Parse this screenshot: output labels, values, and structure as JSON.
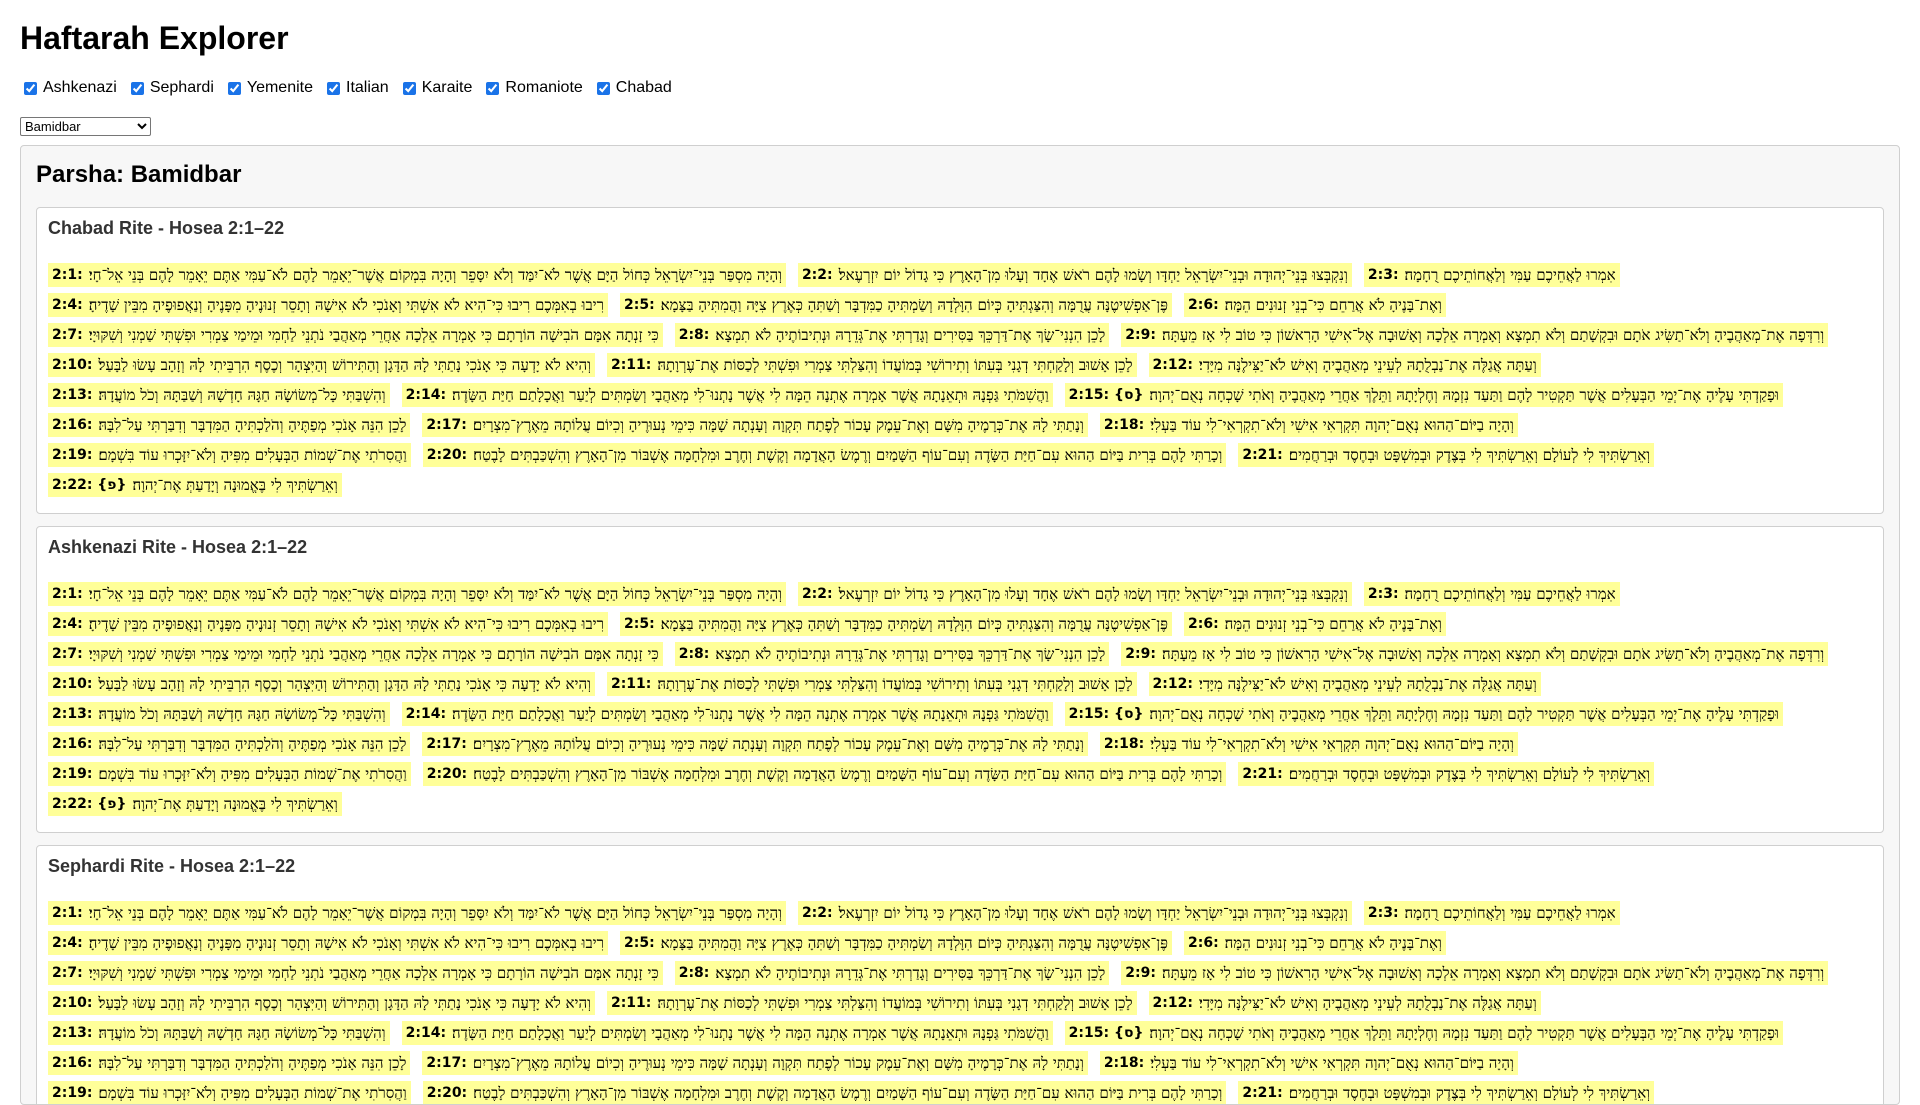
{
  "app": {
    "title": "Haftarah Explorer"
  },
  "filters": [
    {
      "label": "Ashkenazi",
      "checked": true
    },
    {
      "label": "Sephardi",
      "checked": true
    },
    {
      "label": "Yemenite",
      "checked": true
    },
    {
      "label": "Italian",
      "checked": true
    },
    {
      "label": "Karaite",
      "checked": true
    },
    {
      "label": "Romaniote",
      "checked": true
    },
    {
      "label": "Chabad",
      "checked": true
    }
  ],
  "parsha_select": {
    "selected": "Bamidbar"
  },
  "parsha": {
    "title": "Parsha: Bamidbar"
  },
  "verses": [
    {
      "ref": "2:1:",
      "text": "וְהָיָה מִסְפַּר בְּנֵי־יִשְׂרָאֵל כְּחוֹל הַיָּם אֲשֶׁר לֹא־יִמַּד וְלֹא יִסָּפֵר וְהָיָה בִּמְקוֹם אֲשֶׁר־יֵאָמֵר לָהֶם לֹא־עַמִּי אַתֶּם יֵאָמֵר לָהֶם בְּנֵי אֵל־חָי׃"
    },
    {
      "ref": "2:2:",
      "text": "וְנִקְבְּצוּ בְּנֵי־יְהוּדָה וּבְנֵי־יִשְׂרָאֵל יַחְדָּו וְשָׂמוּ לָהֶם רֹאשׁ אֶחָד וְעָלוּ מִן־הָאָרֶץ כִּי גָדוֹל יוֹם יִזְרְעֶאל׃"
    },
    {
      "ref": "2:3:",
      "text": "אִמְרוּ לַאֲחֵיכֶם עַמִּי וְלַאֲחוֹתֵיכֶם רֻחָמָה׃"
    },
    {
      "ref": "2:4:",
      "text": "רִיבוּ בְאִמְּכֶם רִיבוּ כִּי־הִיא לֹא אִשְׁתִּי וְאָנֹכִי לֹא אִישָׁהּ וְתָסֵר זְנוּנֶיהָ מִפָּנֶיהָ וְנַאֲפוּפֶיהָ מִבֵּין שָׁדֶיהָ׃"
    },
    {
      "ref": "2:5:",
      "text": "פֶּן־אַפְשִׁיטֶנָּה עֲרֻמָּה וְהִצַּגְתִּיהָ כְּיוֹם הִוָּלְדָהּ וְשַׂמְתִּיהָ כַמִּדְבָּר וְשַׁתִּהָ כְּאֶרֶץ צִיָּה וַהֲמִתִּיהָ בַּצָּמָא׃"
    },
    {
      "ref": "2:6:",
      "text": "וְאֶת־בָּנֶיהָ לֹא אֲרַחֵם כִּי־בְנֵי זְנוּנִים הֵמָּה׃"
    },
    {
      "ref": "2:7:",
      "text": "כִּי זָנְתָה אִמָּם הֹבִישָׁה הוֹרָתָם כִּי אָמְרָה אֵלְכָה אַחֲרֵי מְאַהֲבַי נֹתְנֵי לַחְמִי וּמֵימַי צַמְרִי וּפִשְׁתִּי שַׁמְנִי וְשִׁקּוּיָי׃"
    },
    {
      "ref": "2:8:",
      "text": "לָכֵן הִנְנִי־שָׂךְ אֶת־דַּרְכֵּךְ בַּסִּירִים וְגָדַרְתִּי אֶת־גְּדֵרָהּ וּנְתִיבוֹתֶיהָ לֹא תִמְצָא׃"
    },
    {
      "ref": "2:9:",
      "text": "וְרִדְּפָה אֶת־מְאַהֲבֶיהָ וְלֹא־תַשִּׂיג אֹתָם וּבִקְשָׁתַם וְלֹא תִמְצָא וְאָמְרָה אֵלְכָה וְאָשׁוּבָה אֶל־אִישִׁי הָרִאשׁוֹן כִּי טוֹב לִי אָז מֵעָתָּה׃"
    },
    {
      "ref": "2:10:",
      "text": "וְהִיא לֹא יָדְעָה כִּי אָנֹכִי נָתַתִּי לָהּ הַדָּגָן וְהַתִּירוֹשׁ וְהַיִּצְהָר וְכֶסֶף הִרְבֵּיתִי לָהּ וְזָהָב עָשׂוּ לַבָּעַל׃"
    },
    {
      "ref": "2:11:",
      "text": "לָכֵן אָשׁוּב וְלָקַחְתִּי דְגָנִי בְּעִתּוֹ וְתִירוֹשִׁי בְּמוֹעֲדוֹ וְהִצַּלְתִּי צַמְרִי וּפִשְׁתִּי לְכַסּוֹת אֶת־עֶרְוָתָהּ׃"
    },
    {
      "ref": "2:12:",
      "text": "וְעַתָּה אֲגַלֶּה אֶת־נַבְלֻתָהּ לְעֵינֵי מְאַהֲבֶיהָ וְאִישׁ לֹא־יַצִּילֶנָּה מִיָּדִי׃"
    },
    {
      "ref": "2:13:",
      "text": "וְהִשְׁבַּתִּי כָּל־מְשׂוֹשָׂהּ חַגָּהּ חָדְשָׁהּ וְשַׁבַּתָּהּ וְכֹל מוֹעֲדָהּ׃"
    },
    {
      "ref": "2:14:",
      "text": "וַהֲשִׁמֹּתִי גַּפְנָהּ וּתְאֵנָתָהּ אֲשֶׁר אָמְרָה אֶתְנָה הֵמָּה לִי אֲשֶׁר נָתְנוּ־לִי מְאַהֲבָי וְשַׂמְתִּים לְיַעַר וַאֲכָלָתַם חַיַּת הַשָּׂדֶה׃"
    },
    {
      "ref": "2:15: {ס}",
      "text": "וּפָקַדְתִּי עָלֶיהָ אֶת־יְמֵי הַבְּעָלִים אֲשֶׁר תַּקְטִיר לָהֶם וַתַּעַד נִזְמָהּ וְחֶלְיָתָהּ וַתֵּלֶךְ אַחֲרֵי מְאַהֲבֶיהָ וְאֹתִי שָׁכְחָה נְאֻם־יְהוָה׃"
    },
    {
      "ref": "2:16:",
      "text": "לָכֵן הִנֵּה אָנֹכִי מְפַתֶּיהָ וְהֹלַכְתִּיהָ הַמִּדְבָּר וְדִבַּרְתִּי עַל־לִבָּהּ׃"
    },
    {
      "ref": "2:17:",
      "text": "וְנָתַתִּי לָהּ אֶת־כְּרָמֶיהָ מִשָּׁם וְאֶת־עֵמֶק עָכוֹר לְפֶתַח תִּקְוָה וְעָנְתָה שָׁמָּה כִּימֵי נְעוּרֶיהָ וְכִיוֹם עֲלוֹתָהּ מֵאֶרֶץ־מִצְרָיִם׃"
    },
    {
      "ref": "2:18:",
      "text": "וְהָיָה בַיּוֹם־הַהוּא נְאֻם־יְהוָה תִּקְרְאִי אִישִׁי וְלֹא־תִקְרְאִי־לִי עוֹד בַּעְלִי׃"
    },
    {
      "ref": "2:19:",
      "text": "וַהֲסִרֹתִי אֶת־שְׁמוֹת הַבְּעָלִים מִפִּיהָ וְלֹא־יִזָּכְרוּ עוֹד בִּשְׁמָם׃"
    },
    {
      "ref": "2:20:",
      "text": "וְכָרַתִּי לָהֶם בְּרִית בַּיּוֹם הַהוּא עִם־חַיַּת הַשָּׂדֶה וְעִם־עוֹף הַשָּׁמַיִם וְרֶמֶשׂ הָאֲדָמָה וְקֶשֶׁת וְחֶרֶב וּמִלְחָמָה אֶשְׁבּוֹר מִן־הָאָרֶץ וְהִשְׁכַּבְתִּים לָבֶטַח׃"
    },
    {
      "ref": "2:21:",
      "text": "וְאֵרַשְׂתִּיךְ לִי לְעוֹלָם וְאֵרַשְׂתִּיךְ לִי בְּצֶדֶק וּבְמִשְׁפָּט וּבְחֶסֶד וּבְרַחֲמִים׃"
    },
    {
      "ref": "2:22: {פ}",
      "text": "וְאֵרַשְׂתִּיךְ לִי בֶּאֱמוּנָה וְיָדַעַתְּ אֶת־יְהוָה׃"
    }
  ],
  "rites": [
    {
      "title": "Chabad Rite - Hosea 2:1–22"
    },
    {
      "title": "Ashkenazi Rite - Hosea 2:1–22"
    },
    {
      "title": "Sephardi Rite - Hosea 2:1–22"
    }
  ]
}
